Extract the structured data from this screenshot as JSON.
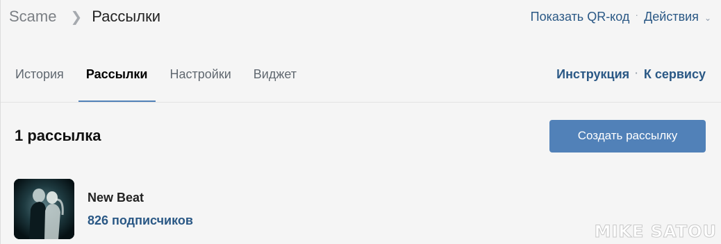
{
  "breadcrumb": {
    "root": "Scame",
    "current": "Рассылки"
  },
  "top_actions": {
    "qr": "Показать QR-код",
    "actions": "Действия"
  },
  "tabs": [
    {
      "label": "История",
      "active": false
    },
    {
      "label": "Рассылки",
      "active": true
    },
    {
      "label": "Настройки",
      "active": false
    },
    {
      "label": "Виджет",
      "active": false
    }
  ],
  "tab_links": {
    "instruction": "Инструкция",
    "service": "К сервису"
  },
  "content": {
    "count_title": "1 рассылка",
    "create_button": "Создать рассылку"
  },
  "mailing": {
    "name": "New Beat",
    "subscribers": "826 подписчиков"
  },
  "watermark": "MIKE SATOU",
  "colors": {
    "accent": "#5181b8",
    "link": "#2a5885"
  }
}
